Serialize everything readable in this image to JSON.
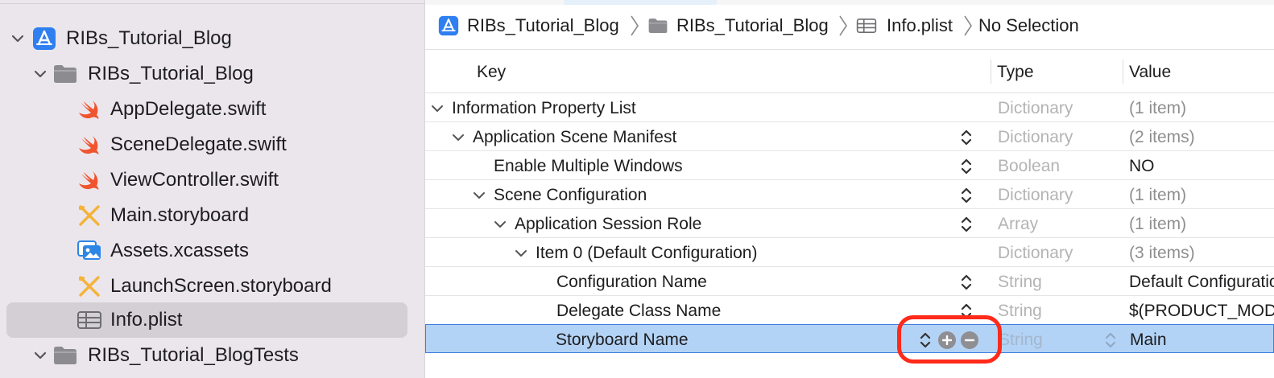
{
  "sidebar": {
    "items": [
      {
        "label": "RIBs_Tutorial_Blog",
        "icon": "xcode-project-icon",
        "chevron": "expanded"
      },
      {
        "label": "RIBs_Tutorial_Blog",
        "icon": "folder-icon",
        "chevron": "expanded"
      },
      {
        "label": "AppDelegate.swift",
        "icon": "swift-file-icon"
      },
      {
        "label": "SceneDelegate.swift",
        "icon": "swift-file-icon"
      },
      {
        "label": "ViewController.swift",
        "icon": "swift-file-icon"
      },
      {
        "label": "Main.storyboard",
        "icon": "storyboard-icon"
      },
      {
        "label": "Assets.xcassets",
        "icon": "asset-catalog-icon"
      },
      {
        "label": "LaunchScreen.storyboard",
        "icon": "storyboard-icon"
      },
      {
        "label": "Info.plist",
        "icon": "plist-table-icon",
        "selected": true
      },
      {
        "label": "RIBs_Tutorial_BlogTests",
        "icon": "folder-icon",
        "chevron": "expanded"
      }
    ]
  },
  "jumpbar": {
    "crumbs": [
      "RIBs_Tutorial_Blog",
      "RIBs_Tutorial_Blog",
      "Info.plist",
      "No Selection"
    ]
  },
  "plist": {
    "columns": {
      "key": "Key",
      "type": "Type",
      "value": "Value"
    },
    "rows": [
      {
        "key": "Information Property List",
        "type": "Dictionary",
        "value": "(1 item)",
        "depth": 0,
        "expanded": true
      },
      {
        "key": "Application Scene Manifest",
        "type": "Dictionary",
        "value": "(2 items)",
        "depth": 1,
        "expanded": true
      },
      {
        "key": "Enable Multiple Windows",
        "type": "Boolean",
        "value": "NO",
        "depth": 2
      },
      {
        "key": "Scene Configuration",
        "type": "Dictionary",
        "value": "(1 item)",
        "depth": 2,
        "expanded": true
      },
      {
        "key": "Application Session Role",
        "type": "Array",
        "value": "(1 item)",
        "depth": 3,
        "expanded": true
      },
      {
        "key": "Item 0 (Default Configuration)",
        "type": "Dictionary",
        "value": "(3 items)",
        "depth": 4,
        "expanded": true
      },
      {
        "key": "Configuration Name",
        "type": "String",
        "value": "Default Configuration",
        "depth": 5
      },
      {
        "key": "Delegate Class Name",
        "type": "String",
        "value": "$(PRODUCT_MODULE_NAME).SceneDelegate",
        "depth": 5
      },
      {
        "key": "Storyboard Name",
        "type": "String",
        "value": "Main",
        "depth": 5,
        "selected": true
      }
    ]
  },
  "colors": {
    "selection_row": "#b3d3f6",
    "selection_border": "#3d7ee0",
    "highlight_ring": "#ff2a1a",
    "sidebar_bg": "#ebe6ec",
    "swift_orange": "#f0542e"
  }
}
